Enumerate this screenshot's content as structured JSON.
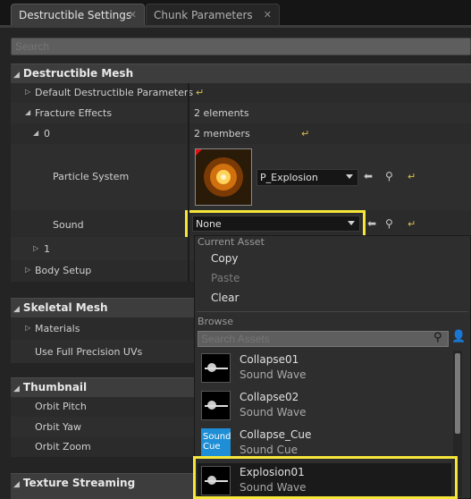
{
  "tabs": [
    {
      "label": "Destructible Settings",
      "close": "✕"
    },
    {
      "label": "Chunk Parameters",
      "close": "✕"
    }
  ],
  "search": {
    "placeholder": "Search"
  },
  "destructible_mesh": {
    "title": "Destructible Mesh",
    "default_params_label": "Default Destructible Parameters",
    "fracture_effects_label": "Fracture Effects",
    "fracture_effects_value": "2 elements",
    "index0_label": "0",
    "index0_value": "2 members",
    "particle_system_label": "Particle System",
    "particle_system_value": "P_Explosion",
    "sound_label": "Sound",
    "sound_value": "None",
    "index1_label": "1",
    "body_setup_label": "Body Setup"
  },
  "skeletal_mesh": {
    "title": "Skeletal Mesh",
    "materials_label": "Materials",
    "full_precision_label": "Use Full Precision UVs"
  },
  "thumbnail": {
    "title": "Thumbnail",
    "orbit_pitch": "Orbit Pitch",
    "orbit_yaw": "Orbit Yaw",
    "orbit_zoom": "Orbit Zoom"
  },
  "texture_streaming": {
    "title": "Texture Streaming"
  },
  "dropdown": {
    "current_asset_header": "Current Asset",
    "copy": "Copy",
    "paste": "Paste",
    "clear": "Clear",
    "browse_header": "Browse",
    "search_placeholder": "Search Assets",
    "assets": [
      {
        "name": "Collapse01",
        "type": "Sound Wave",
        "thumb": "sound-wave"
      },
      {
        "name": "Collapse02",
        "type": "Sound Wave",
        "thumb": "sound-wave"
      },
      {
        "name": "Collapse_Cue",
        "type": "Sound Cue",
        "thumb": "sound-cue",
        "thumb_text": "Sound Cue"
      },
      {
        "name": "Explosion01",
        "type": "Sound Wave",
        "thumb": "sound-wave"
      }
    ]
  },
  "colors": {
    "highlight": "#f5e639",
    "reset_arrow": "#d8c14a",
    "sound_cue_thumb": "#1e8fd6"
  }
}
